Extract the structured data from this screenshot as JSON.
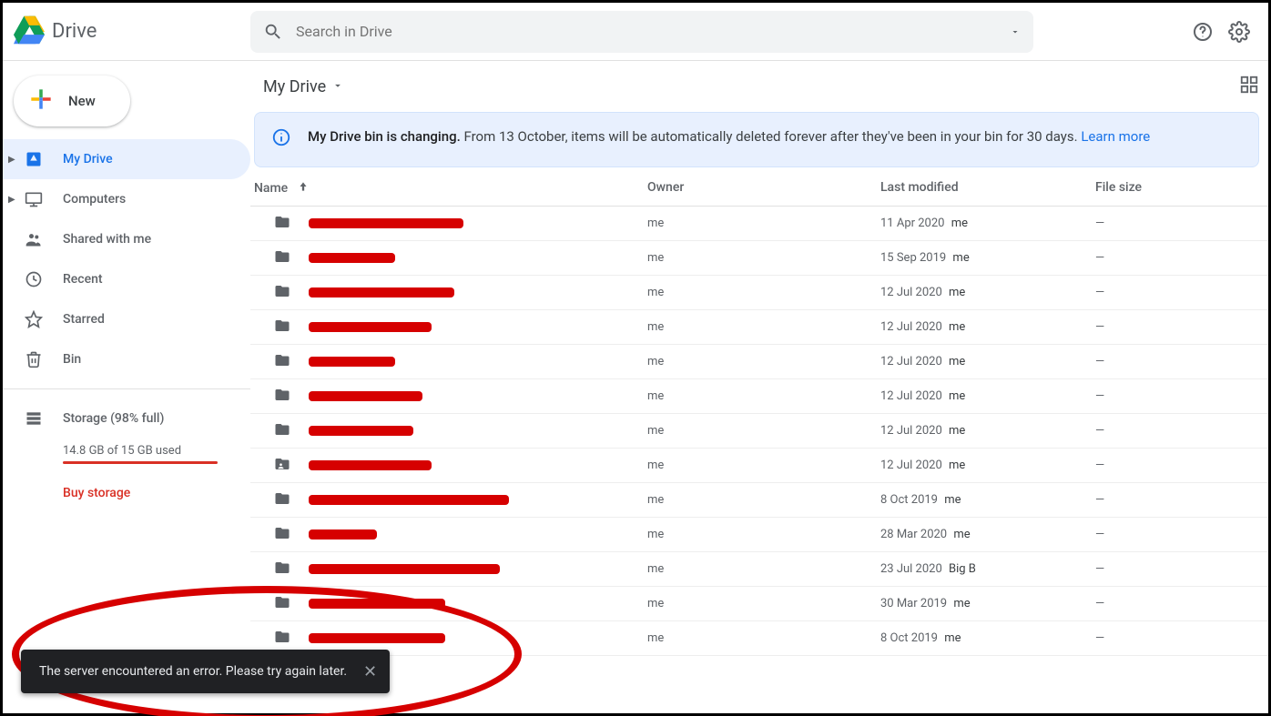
{
  "app_name": "Drive",
  "search_placeholder": "Search in Drive",
  "new_button_label": "New",
  "sidebar": {
    "items": [
      {
        "label": "My Drive",
        "icon": "drive-icon",
        "active": true,
        "expandable": true
      },
      {
        "label": "Computers",
        "icon": "computers-icon",
        "active": false,
        "expandable": true
      },
      {
        "label": "Shared with me",
        "icon": "shared-icon",
        "active": false,
        "expandable": false
      },
      {
        "label": "Recent",
        "icon": "recent-icon",
        "active": false,
        "expandable": false
      },
      {
        "label": "Starred",
        "icon": "star-icon",
        "active": false,
        "expandable": false
      },
      {
        "label": "Bin",
        "icon": "bin-icon",
        "active": false,
        "expandable": false
      }
    ],
    "storage_label": "Storage (98% full)",
    "storage_usage": "14.8 GB of 15 GB used",
    "buy_label": "Buy storage"
  },
  "breadcrumb": "My Drive",
  "banner": {
    "bold": "My Drive bin is changing.",
    "text": " From 13 October, items will be automatically deleted forever after they've been in your bin for 30 days. ",
    "link": "Learn more"
  },
  "columns": {
    "name": "Name",
    "owner": "Owner",
    "modified": "Last modified",
    "size": "File size"
  },
  "rows": [
    {
      "redact_w": 170,
      "owner": "me",
      "modified": "11 Apr 2020",
      "mod_by": "me",
      "size": "—",
      "shared": false
    },
    {
      "redact_w": 95,
      "owner": "me",
      "modified": "15 Sep 2019",
      "mod_by": "me",
      "size": "—",
      "shared": false
    },
    {
      "redact_w": 160,
      "owner": "me",
      "modified": "12 Jul 2020",
      "mod_by": "me",
      "size": "—",
      "shared": false
    },
    {
      "redact_w": 135,
      "owner": "me",
      "modified": "12 Jul 2020",
      "mod_by": "me",
      "size": "—",
      "shared": false
    },
    {
      "redact_w": 95,
      "owner": "me",
      "modified": "12 Jul 2020",
      "mod_by": "me",
      "size": "—",
      "shared": false
    },
    {
      "redact_w": 125,
      "owner": "me",
      "modified": "12 Jul 2020",
      "mod_by": "me",
      "size": "—",
      "shared": false
    },
    {
      "redact_w": 115,
      "owner": "me",
      "modified": "12 Jul 2020",
      "mod_by": "me",
      "size": "—",
      "shared": false
    },
    {
      "redact_w": 135,
      "owner": "me",
      "modified": "12 Jul 2020",
      "mod_by": "me",
      "size": "—",
      "shared": true
    },
    {
      "redact_w": 220,
      "owner": "me",
      "modified": "8 Oct 2019",
      "mod_by": "me",
      "size": "—",
      "shared": false
    },
    {
      "redact_w": 75,
      "owner": "me",
      "modified": "28 Mar 2020",
      "mod_by": "me",
      "size": "—",
      "shared": false
    },
    {
      "redact_w": 210,
      "owner": "me",
      "modified": "23 Jul 2020",
      "mod_by": "Big B",
      "size": "—",
      "shared": false
    },
    {
      "redact_w": 150,
      "owner": "me",
      "modified": "30 Mar 2019",
      "mod_by": "me",
      "size": "—",
      "shared": false
    },
    {
      "redact_w": 150,
      "owner": "me",
      "modified": "8 Oct 2019",
      "mod_by": "me",
      "size": "—",
      "shared": false
    }
  ],
  "toast": "The server encountered an error. Please try again later."
}
